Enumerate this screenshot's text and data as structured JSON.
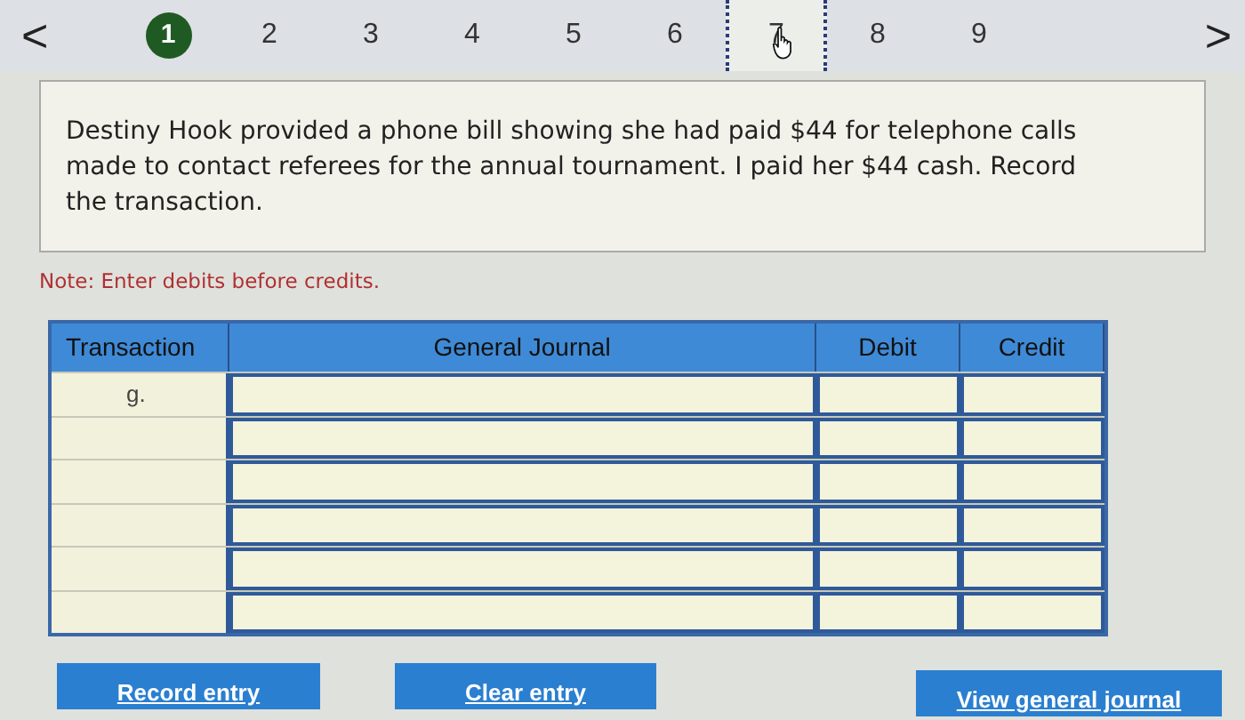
{
  "pager": {
    "prev": "<",
    "next": ">",
    "tabs": [
      {
        "label": "1",
        "completed": true,
        "selected": false
      },
      {
        "label": "2",
        "completed": false,
        "selected": false
      },
      {
        "label": "3",
        "completed": false,
        "selected": false
      },
      {
        "label": "4",
        "completed": false,
        "selected": false
      },
      {
        "label": "5",
        "completed": false,
        "selected": false
      },
      {
        "label": "6",
        "completed": false,
        "selected": false
      },
      {
        "label": "7",
        "completed": false,
        "selected": true
      },
      {
        "label": "8",
        "completed": false,
        "selected": false
      },
      {
        "label": "9",
        "completed": false,
        "selected": false
      }
    ]
  },
  "question": "Destiny Hook provided a phone bill showing she had paid $44 for telephone calls made to contact referees for the annual tournament. I paid her $44 cash. Record the transaction.",
  "note": "Note: Enter debits before credits.",
  "table": {
    "columns": [
      "Transaction",
      "General Journal",
      "Debit",
      "Credit"
    ],
    "rows": [
      {
        "transaction": "g."
      },
      {},
      {},
      {},
      {},
      {}
    ]
  },
  "buttons": [
    "Record entry",
    "Clear entry",
    "View general journal"
  ]
}
